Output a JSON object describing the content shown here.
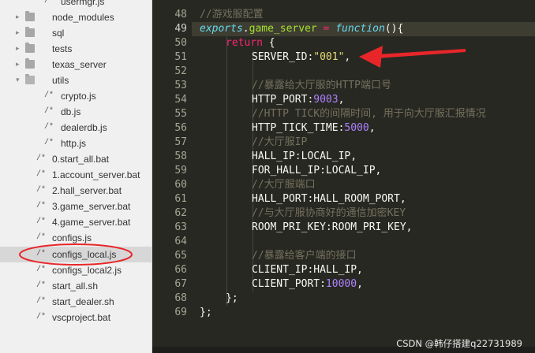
{
  "sidebar": {
    "items": [
      {
        "label": "usermgr.js",
        "kind": "file"
      },
      {
        "label": "node_modules",
        "kind": "folder"
      },
      {
        "label": "sql",
        "kind": "folder"
      },
      {
        "label": "tests",
        "kind": "folder"
      },
      {
        "label": "texas_server",
        "kind": "folder"
      },
      {
        "label": "utils",
        "kind": "folder-open"
      },
      {
        "label": "crypto.js",
        "kind": "file"
      },
      {
        "label": "db.js",
        "kind": "file"
      },
      {
        "label": "dealerdb.js",
        "kind": "file"
      },
      {
        "label": "http.js",
        "kind": "file"
      },
      {
        "label": "0.start_all.bat",
        "kind": "file"
      },
      {
        "label": "1.account_server.bat",
        "kind": "file"
      },
      {
        "label": "2.hall_server.bat",
        "kind": "file"
      },
      {
        "label": "3.game_server.bat",
        "kind": "file"
      },
      {
        "label": "4.game_server.bat",
        "kind": "file"
      },
      {
        "label": "configs.js",
        "kind": "file"
      },
      {
        "label": "configs_local.js",
        "kind": "file",
        "selected": true
      },
      {
        "label": "configs_local2.js",
        "kind": "file"
      },
      {
        "label": "start_all.sh",
        "kind": "file"
      },
      {
        "label": "start_dealer.sh",
        "kind": "file"
      },
      {
        "label": "vscproject.bat",
        "kind": "file"
      }
    ],
    "file_icon_glyph": "/*"
  },
  "editor": {
    "line_numbers": [
      "48",
      "49",
      "50",
      "51",
      "52",
      "53",
      "54",
      "55",
      "56",
      "57",
      "58",
      "59",
      "60",
      "61",
      "62",
      "63",
      "64",
      "65",
      "66",
      "67",
      "68",
      "69"
    ],
    "current_line": "49",
    "lines": {
      "l48": "//游戏服配置",
      "l49_obj": "exports",
      "l49_dot": ".",
      "l49_prop": "game_server",
      "l49_eq": " = ",
      "l49_fn": "function",
      "l49_end": "(){",
      "l50_kw": "return",
      "l50_end": " {",
      "l51_key": "SERVER_ID:",
      "l51_str": "\"001\"",
      "l51_end": ",",
      "l53": "//暴露给大厅服的HTTP端口号",
      "l54_key": "HTTP_PORT:",
      "l54_num": "9003",
      "l54_end": ",",
      "l55": "//HTTP TICK的间隔时间, 用于向大厅服汇报情况",
      "l56_key": "HTTP_TICK_TIME:",
      "l56_num": "5000",
      "l56_end": ",",
      "l57": "//大厅服IP",
      "l58": "HALL_IP:LOCAL_IP,",
      "l59": "FOR_HALL_IP:LOCAL_IP,",
      "l60": "//大厅服端口",
      "l61": "HALL_PORT:HALL_ROOM_PORT,",
      "l62": "//与大厅服协商好的通信加密KEY",
      "l63": "ROOM_PRI_KEY:ROOM_PRI_KEY,",
      "l65": "//暴露给客户端的接口",
      "l66": "CLIENT_IP:HALL_IP,",
      "l67_key": "CLIENT_PORT:",
      "l67_num": "10000",
      "l67_end": ",",
      "l68": "};",
      "l69": "};"
    }
  },
  "annotations": {
    "arrow_color": "#e8262a",
    "ellipse_color": "#e8262a"
  },
  "watermark": "CSDN @韩仔搭建q22731989"
}
